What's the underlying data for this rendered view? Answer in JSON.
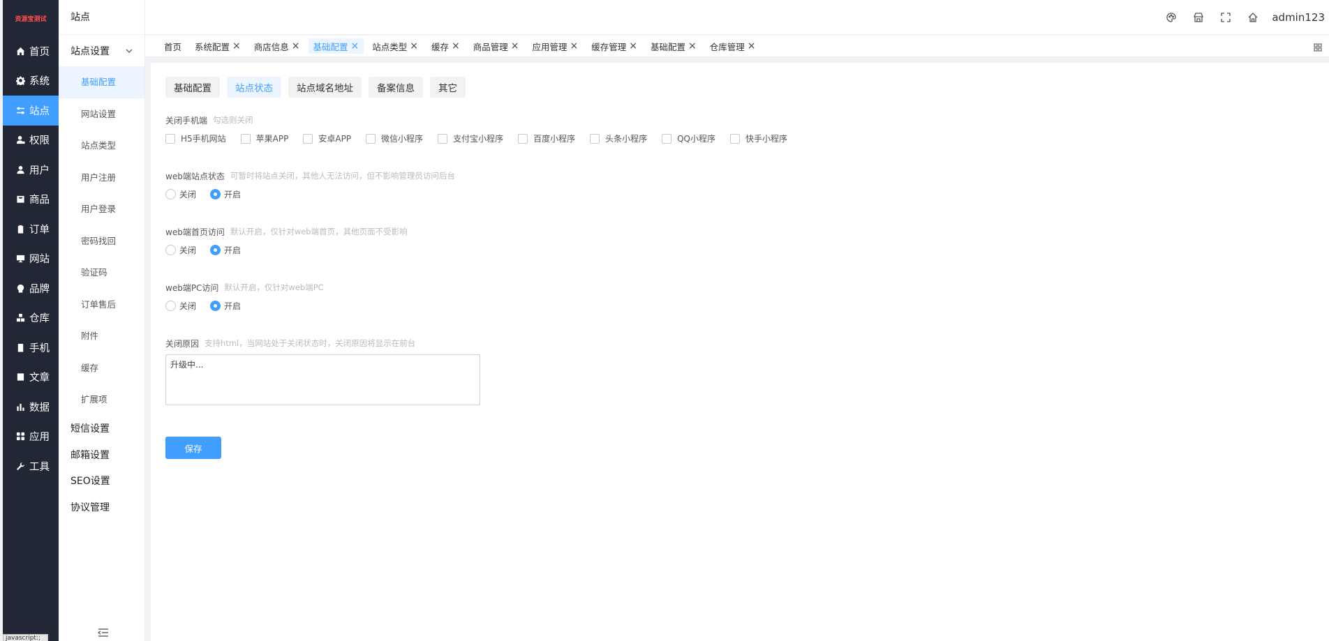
{
  "brand": {
    "logo_text": "资源宝测试"
  },
  "leftnav": [
    {
      "label": "首页",
      "icon": "home-icon"
    },
    {
      "label": "系统",
      "icon": "gear-icon"
    },
    {
      "label": "站点",
      "icon": "sliders-icon",
      "active": true
    },
    {
      "label": "权限",
      "icon": "user-lock-icon"
    },
    {
      "label": "用户",
      "icon": "user-icon"
    },
    {
      "label": "商品",
      "icon": "bag-icon"
    },
    {
      "label": "订单",
      "icon": "clipboard-icon"
    },
    {
      "label": "网站",
      "icon": "monitor-icon"
    },
    {
      "label": "品牌",
      "icon": "brand-icon"
    },
    {
      "label": "仓库",
      "icon": "boxes-icon"
    },
    {
      "label": "手机",
      "icon": "phone-icon"
    },
    {
      "label": "文章",
      "icon": "article-icon"
    },
    {
      "label": "数据",
      "icon": "bar-chart-icon"
    },
    {
      "label": "应用",
      "icon": "apps-icon"
    },
    {
      "label": "工具",
      "icon": "wrench-icon"
    }
  ],
  "tooltip": {
    "text": "javascript:;"
  },
  "subnav": {
    "title": "站点",
    "group_label": "站点设置",
    "items": [
      "基础配置",
      "网站设置",
      "站点类型",
      "用户注册",
      "用户登录",
      "密码找回",
      "验证码",
      "订单售后",
      "附件",
      "缓存",
      "扩展项"
    ],
    "active_index": 0,
    "groups_after": [
      "短信设置",
      "邮箱设置",
      "SEO设置",
      "协议管理"
    ]
  },
  "header": {
    "username": "admin123"
  },
  "tabs": [
    {
      "label": "首页",
      "closable": false
    },
    {
      "label": "系统配置",
      "closable": true
    },
    {
      "label": "商店信息",
      "closable": true
    },
    {
      "label": "基础配置",
      "closable": true,
      "active": true
    },
    {
      "label": "站点类型",
      "closable": true
    },
    {
      "label": "缓存",
      "closable": true
    },
    {
      "label": "商品管理",
      "closable": true
    },
    {
      "label": "应用管理",
      "closable": true
    },
    {
      "label": "缓存管理",
      "closable": true
    },
    {
      "label": "基础配置",
      "closable": true
    },
    {
      "label": "仓库管理",
      "closable": true
    }
  ],
  "subtabs": [
    {
      "label": "基础配置"
    },
    {
      "label": "站点状态",
      "active": true
    },
    {
      "label": "站点域名地址"
    },
    {
      "label": "备案信息"
    },
    {
      "label": "其它"
    }
  ],
  "form": {
    "mobile_close": {
      "label": "关闭手机端",
      "hint": "勾选则关闭",
      "options": [
        "H5手机网站",
        "苹果APP",
        "安卓APP",
        "微信小程序",
        "支付宝小程序",
        "百度小程序",
        "头条小程序",
        "QQ小程序",
        "快手小程序"
      ],
      "checked": []
    },
    "web_status": {
      "label": "web端站点状态",
      "hint": "可暂时将站点关闭，其他人无法访问，但不影响管理员访问后台",
      "off": "关闭",
      "on": "开启",
      "value": "on"
    },
    "web_home": {
      "label": "web端首页访问",
      "hint": "默认开启，仅针对web端首页，其他页面不受影响",
      "off": "关闭",
      "on": "开启",
      "value": "on"
    },
    "web_pc": {
      "label": "web端PC访问",
      "hint": "默认开启，仅针对web端PC",
      "off": "关闭",
      "on": "开启",
      "value": "on"
    },
    "close_reason": {
      "label": "关闭原因",
      "hint": "支持html，当网站处于关闭状态时，关闭原因将显示在前台",
      "value": "升级中..."
    },
    "save_label": "保存"
  },
  "colors": {
    "accent": "#409eff",
    "nav_bg": "#212734"
  }
}
